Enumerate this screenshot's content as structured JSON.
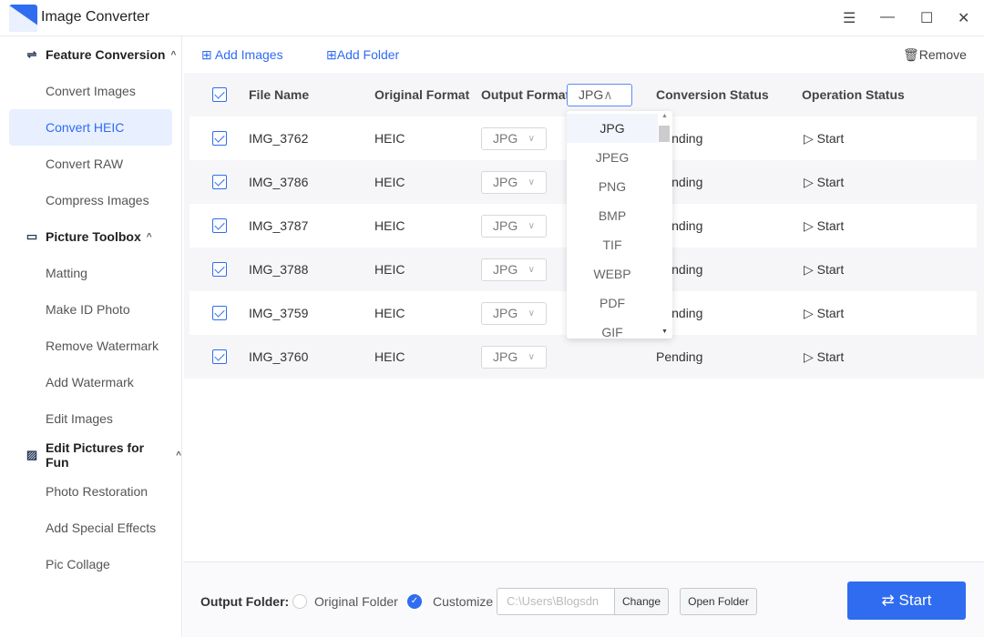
{
  "app": {
    "title": "Image Converter",
    "accent": "#2f6cf0"
  },
  "window": {
    "menu": "☰",
    "minimize": "—",
    "maximize": "☐",
    "close": "✕"
  },
  "sidebar": {
    "groups": [
      {
        "label": "Feature Conversion",
        "icon": "feature-conversion-icon",
        "items": [
          "Convert Images",
          "Convert HEIC",
          "Convert RAW",
          "Compress Images"
        ]
      },
      {
        "label": "Picture Toolbox",
        "icon": "toolbox-icon",
        "items": [
          "Matting",
          "Make ID Photo",
          "Remove Watermark",
          "Add Watermark",
          "Edit Images"
        ]
      },
      {
        "label": "Edit Pictures for Fun",
        "icon": "picture-icon",
        "items": [
          "Photo Restoration",
          "Add Special Effects",
          "Pic Collage"
        ]
      }
    ],
    "active": "Convert HEIC"
  },
  "toolbar": {
    "add_images": "Add Images",
    "add_folder": "Add Folder",
    "remove": "Remove"
  },
  "table": {
    "headers": {
      "file_name": "File Name",
      "original_format": "Original Format",
      "output_format": "Output Format",
      "output_format_value": "JPG",
      "conversion_status": "Conversion Status",
      "operation_status": "Operation Status"
    },
    "rows": [
      {
        "name": "IMG_3762",
        "orig": "HEIC",
        "out": "JPG",
        "status": "Pending",
        "op": "Start"
      },
      {
        "name": "IMG_3786",
        "orig": "HEIC",
        "out": "JPG",
        "status": "Pending",
        "op": "Start"
      },
      {
        "name": "IMG_3787",
        "orig": "HEIC",
        "out": "JPG",
        "status": "Pending",
        "op": "Start"
      },
      {
        "name": "IMG_3788",
        "orig": "HEIC",
        "out": "JPG",
        "status": "Pending",
        "op": "Start"
      },
      {
        "name": "IMG_3759",
        "orig": "HEIC",
        "out": "JPG",
        "status": "Pending",
        "op": "Start"
      },
      {
        "name": "IMG_3760",
        "orig": "HEIC",
        "out": "JPG",
        "status": "Pending",
        "op": "Start"
      }
    ]
  },
  "dropdown": {
    "options": [
      "JPG",
      "JPEG",
      "PNG",
      "BMP",
      "TIF",
      "WEBP",
      "PDF",
      "GIF"
    ],
    "selected": "JPG"
  },
  "footer": {
    "label": "Output Folder:",
    "original": "Original Folder",
    "customize": "Customize",
    "path": "C:\\Users\\Blogsdn",
    "change": "Change",
    "open": "Open Folder",
    "start": "Start"
  }
}
